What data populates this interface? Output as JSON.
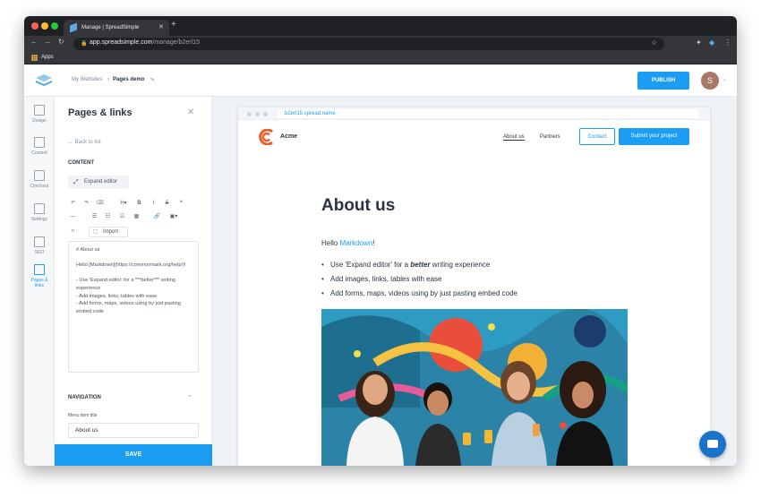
{
  "browser": {
    "tab_title": "Manage | SpreadSimple",
    "url_domain": "app.spreadsimple.com",
    "url_path": "/manage/b2erl15",
    "bookmarks_label": "Apps"
  },
  "app": {
    "breadcrumb_root": "My Websites",
    "breadcrumb_sep": "›",
    "breadcrumb_current": "Pages demo",
    "publish_label": "PUBLISH",
    "avatar_initial": "S",
    "accent_color": "#1a9df2"
  },
  "rail": {
    "items": [
      {
        "label": "Design",
        "icon": "design-icon"
      },
      {
        "label": "Content",
        "icon": "content-icon"
      },
      {
        "label": "Checkout",
        "icon": "checkout-icon"
      },
      {
        "label": "Settings",
        "icon": "settings-icon"
      },
      {
        "label": "SEO",
        "icon": "seo-icon"
      },
      {
        "label": "Pages & links",
        "icon": "pages-icon"
      }
    ]
  },
  "panel": {
    "title": "Pages & links",
    "back_label": "Back to list",
    "content_heading": "CONTENT",
    "expand_label": "Expand editor",
    "import_label": "Import",
    "editor_text": "# About us\n\nHello [Markdown](https://commonmark.org/help/)!\n\n- Use 'Expand editor' for a ***better*** writing experience\n- Add images, links, tables with ease\n- Add forms, maps, videos using by just pasting embed code",
    "navigation_heading": "NAVIGATION",
    "menu_item_title_label": "Menu item title",
    "menu_item_title_value": "About us",
    "save_label": "SAVE"
  },
  "preview": {
    "url": "b2erl15.spread.name",
    "site_name": "Acme",
    "nav": [
      "About us",
      "Partners"
    ],
    "contact_label": "Contact",
    "cta_label": "Submit your project",
    "heading": "About us",
    "hello_prefix": "Hello ",
    "hello_link": "Markdown",
    "hello_suffix": "!",
    "bullet1_a": "Use 'Expand editor' for a ",
    "bullet1_b": "better",
    "bullet1_c": " writing experience",
    "bullet2": "Add images, links, tables with ease",
    "bullet3": "Add forms, maps, videos using by just pasting embed code"
  }
}
